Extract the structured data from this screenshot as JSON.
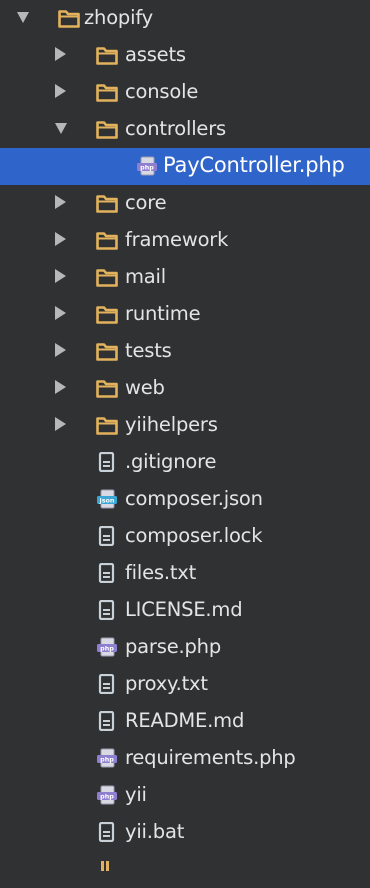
{
  "colors": {
    "background": "#2f3133",
    "selection": "#2f65ca",
    "folder": "#e3b25d",
    "php_badge": "#8f7fd1",
    "json_badge": "#3aa7d8",
    "text_file": "#c9d1d8"
  },
  "tree": [
    {
      "label": "zhopify",
      "kind": "folder",
      "depth": 0,
      "expanded": true
    },
    {
      "label": "assets",
      "kind": "folder",
      "depth": 1,
      "expanded": false
    },
    {
      "label": "console",
      "kind": "folder",
      "depth": 1,
      "expanded": false
    },
    {
      "label": "controllers",
      "kind": "folder",
      "depth": 1,
      "expanded": true
    },
    {
      "label": "PayController.php",
      "kind": "php",
      "depth": 2,
      "selected": true
    },
    {
      "label": "core",
      "kind": "folder",
      "depth": 1,
      "expanded": false
    },
    {
      "label": "framework",
      "kind": "folder",
      "depth": 1,
      "expanded": false
    },
    {
      "label": "mail",
      "kind": "folder",
      "depth": 1,
      "expanded": false
    },
    {
      "label": "runtime",
      "kind": "folder",
      "depth": 1,
      "expanded": false
    },
    {
      "label": "tests",
      "kind": "folder",
      "depth": 1,
      "expanded": false
    },
    {
      "label": "web",
      "kind": "folder",
      "depth": 1,
      "expanded": false
    },
    {
      "label": "yiihelpers",
      "kind": "folder",
      "depth": 1,
      "expanded": false
    },
    {
      "label": ".gitignore",
      "kind": "text",
      "depth": 1
    },
    {
      "label": "composer.json",
      "kind": "json",
      "depth": 1
    },
    {
      "label": "composer.lock",
      "kind": "text",
      "depth": 1
    },
    {
      "label": "files.txt",
      "kind": "text",
      "depth": 1
    },
    {
      "label": "LICENSE.md",
      "kind": "text",
      "depth": 1
    },
    {
      "label": "parse.php",
      "kind": "php",
      "depth": 1
    },
    {
      "label": "proxy.txt",
      "kind": "text",
      "depth": 1
    },
    {
      "label": "README.md",
      "kind": "text",
      "depth": 1
    },
    {
      "label": "requirements.php",
      "kind": "php",
      "depth": 1
    },
    {
      "label": "yii",
      "kind": "php",
      "depth": 1
    },
    {
      "label": "yii.bat",
      "kind": "text",
      "depth": 1
    },
    {
      "label": "",
      "kind": "partial",
      "depth": 1
    }
  ]
}
